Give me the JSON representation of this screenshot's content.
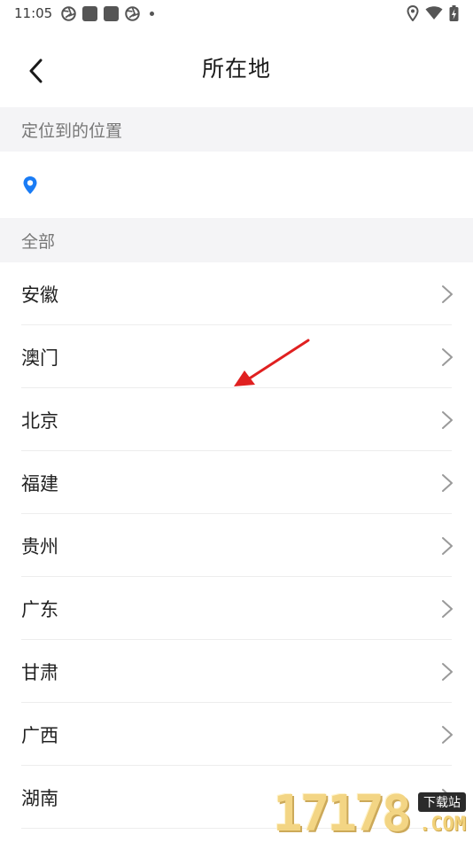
{
  "status_bar": {
    "time": "11:05",
    "left_icons": [
      "aperture-icon",
      "square-icon",
      "square-icon",
      "aperture-icon",
      "dot-icon"
    ],
    "right_icons": [
      "location-icon",
      "wifi-icon",
      "battery-charging-icon"
    ]
  },
  "header": {
    "title": "所在地",
    "back_icon": "chevron-left-icon"
  },
  "located_section": {
    "header": "定位到的位置",
    "icon": "location-pin-icon",
    "icon_color": "#1a7cf5",
    "value": ""
  },
  "all_section": {
    "header": "全部"
  },
  "provinces": [
    {
      "name": "安徽"
    },
    {
      "name": "澳门"
    },
    {
      "name": "北京"
    },
    {
      "name": "福建"
    },
    {
      "name": "贵州"
    },
    {
      "name": "广东"
    },
    {
      "name": "甘肃"
    },
    {
      "name": "广西"
    },
    {
      "name": "湖南"
    }
  ],
  "annotation": {
    "icon": "red-arrow-icon",
    "color": "#e02020"
  },
  "watermark": {
    "digits": "17178",
    "badge": "下载站",
    "suffix": ".COM"
  },
  "colors": {
    "section_bg": "#f4f4f6",
    "section_text": "#777777",
    "divider": "#ededed",
    "chevron": "#9a9a9a"
  }
}
